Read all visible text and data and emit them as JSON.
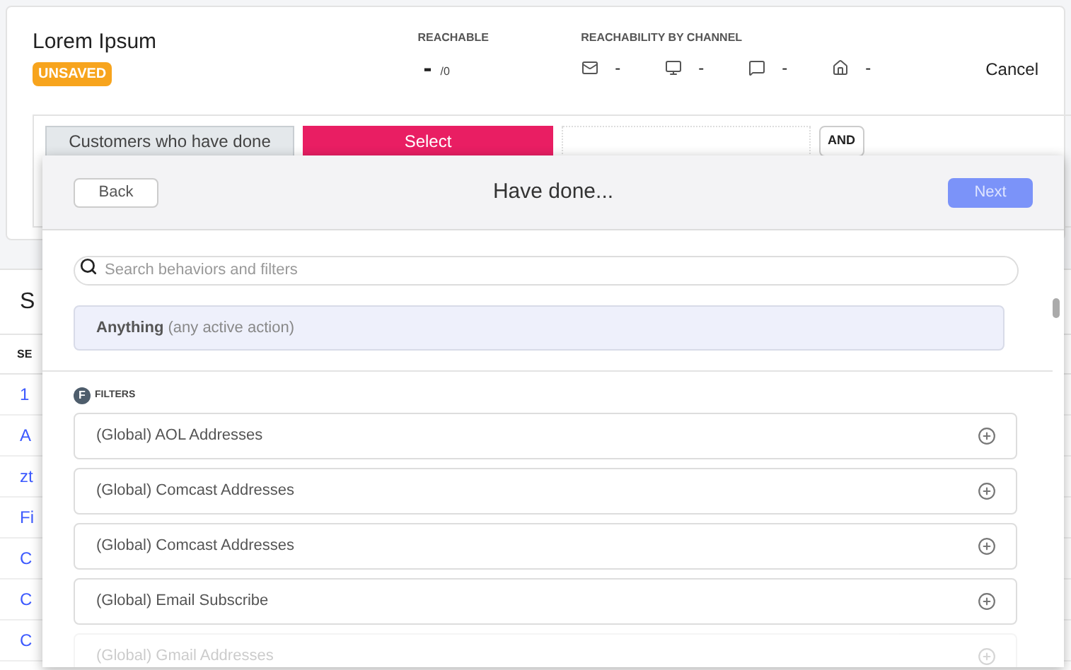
{
  "header": {
    "title": "Lorem Ipsum",
    "badge": "UNSAVED",
    "cancel": "Cancel"
  },
  "reachable": {
    "label": "REACHABLE",
    "value": "-",
    "total": "/0"
  },
  "channels": {
    "label": "REACHABILITY BY CHANNEL",
    "items": [
      {
        "kind": "email",
        "value": "-"
      },
      {
        "kind": "screen",
        "value": "-"
      },
      {
        "kind": "chat",
        "value": "-"
      },
      {
        "kind": "home",
        "value": "-"
      }
    ]
  },
  "criteria": {
    "who": "Customers who have done",
    "select": "Select",
    "and": "AND"
  },
  "background_list": {
    "title": "S",
    "column_1": "SE",
    "rows": [
      "1",
      "A",
      "zt",
      "Fi",
      "C",
      "C",
      "C"
    ]
  },
  "modal": {
    "back": "Back",
    "title": "Have done...",
    "next": "Next",
    "next_disabled": true,
    "search": {
      "placeholder": "Search behaviors and filters"
    },
    "anything": {
      "label": "Anything",
      "hint": "(any active action)"
    },
    "section": {
      "badge": "F",
      "label": "FILTERS"
    },
    "filters": [
      {
        "label": "(Global) AOL Addresses",
        "faded": false
      },
      {
        "label": "(Global) Comcast Addresses",
        "faded": false
      },
      {
        "label": "(Global) Comcast Addresses",
        "faded": false
      },
      {
        "label": "(Global) Email Subscribe",
        "faded": false
      },
      {
        "label": "(Global) Gmail Addresses",
        "faded": true
      }
    ]
  }
}
